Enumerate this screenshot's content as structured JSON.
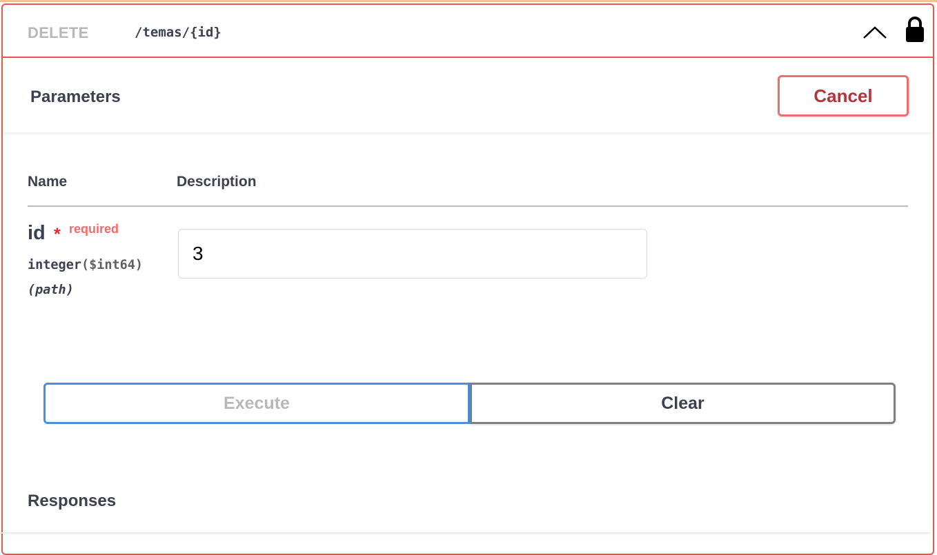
{
  "operation": {
    "method": "DELETE",
    "path": "/temas/{id}",
    "collapse_icon": "chevron-up-icon",
    "lock_icon": "lock-icon"
  },
  "parameters_section": {
    "title": "Parameters",
    "cancel_label": "Cancel",
    "columns": {
      "name": "Name",
      "description": "Description"
    },
    "params": [
      {
        "name": "id",
        "required_marker": "*",
        "required_label": "required",
        "type": "integer",
        "format": "($int64)",
        "in": "(path)",
        "value": "3"
      }
    ]
  },
  "actions": {
    "execute_label": "Execute",
    "clear_label": "Clear"
  },
  "responses_section": {
    "title": "Responses"
  },
  "colors": {
    "delete_border": "#e7574f",
    "cancel": "#f26c6c",
    "execute_border": "#4990e2",
    "clear_border": "#808080",
    "required": "#e02a2a"
  }
}
